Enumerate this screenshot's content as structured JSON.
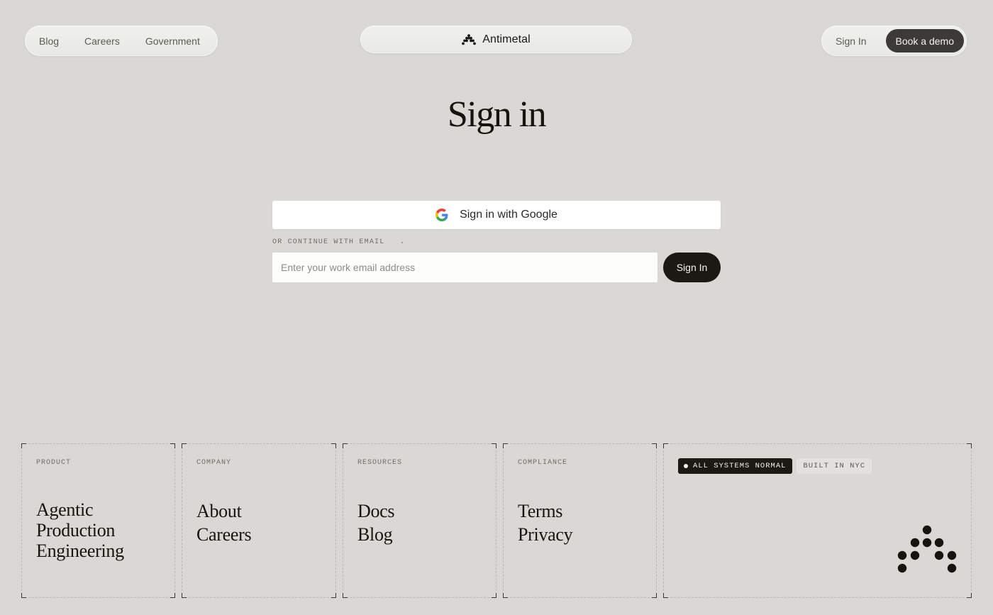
{
  "header": {
    "nav": [
      {
        "label": "Blog"
      },
      {
        "label": "Careers"
      },
      {
        "label": "Government"
      }
    ],
    "brand": {
      "name": "Antimetal",
      "logo_icon": "antimetal-dots-logo"
    },
    "sign_in_label": "Sign In",
    "book_demo_label": "Book a demo"
  },
  "main": {
    "title": "Sign in",
    "google_button_label": "Sign in with Google",
    "google_icon": "google-g-icon",
    "divider_label": "OR CONTINUE WITH EMAIL",
    "email": {
      "value": "",
      "placeholder": "Enter your work email address"
    },
    "submit_label": "Sign In"
  },
  "footer": {
    "product": {
      "label": "PRODUCT",
      "links": [
        "Agentic",
        "Production",
        "Engineering"
      ]
    },
    "company": {
      "label": "COMPANY",
      "links": [
        "About",
        "Careers"
      ]
    },
    "resources": {
      "label": "RESOURCES",
      "links": [
        "Docs",
        "Blog"
      ]
    },
    "compliance": {
      "label": "COMPLIANCE",
      "links": [
        "Terms",
        "Privacy"
      ]
    },
    "status": {
      "system_badge": "ALL SYSTEMS NORMAL",
      "location_badge": "BUILT IN NYC"
    }
  },
  "colors": {
    "background": "#d9d8d4",
    "dark_button": "#1c1915",
    "demo_button": "#3c3a36",
    "card_border": "#b9b7b2"
  }
}
